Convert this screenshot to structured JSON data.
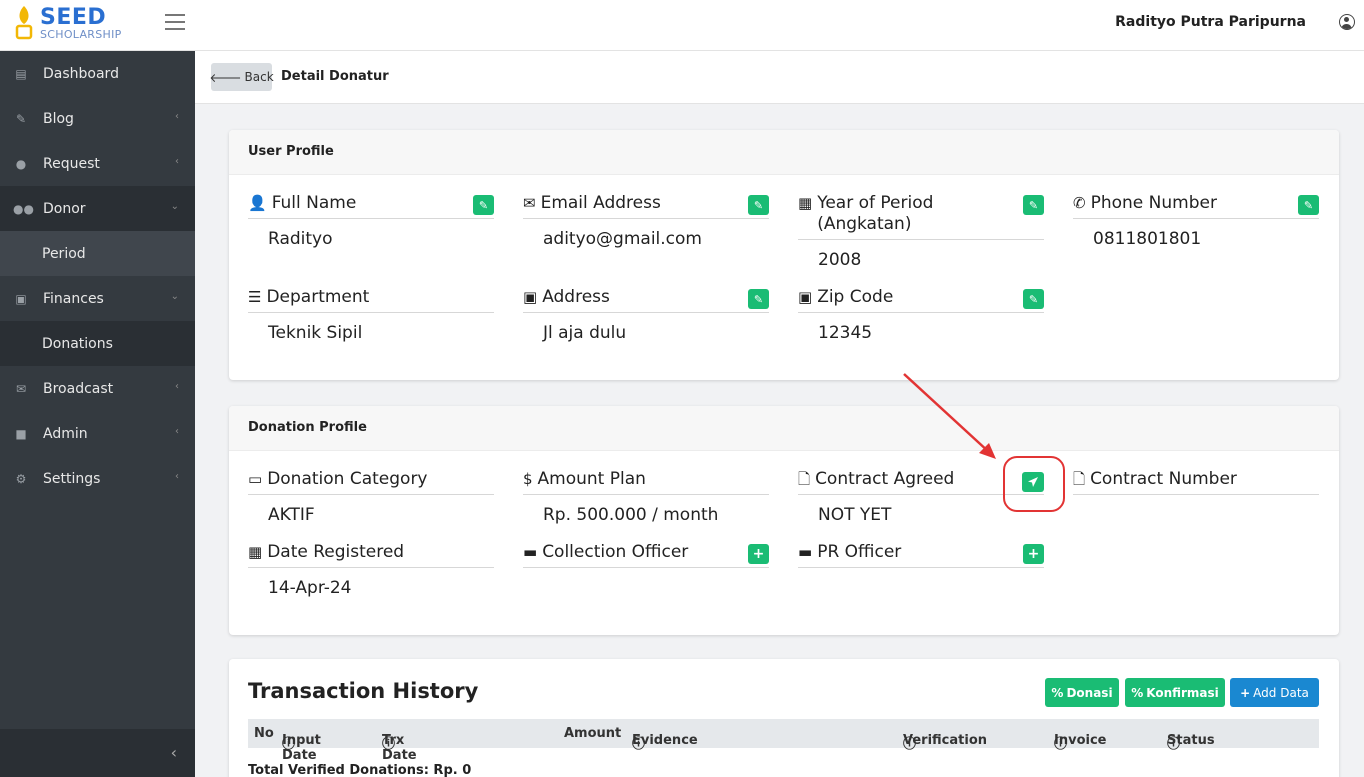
{
  "header": {
    "logo_title": "SEED",
    "logo_subtitle": "SCHOLARSHIP",
    "user_name": "Radityo Putra Paripurna"
  },
  "sidebar": {
    "items": [
      {
        "label": "Dashboard",
        "icon": "bar-chart-icon"
      },
      {
        "label": "Blog",
        "icon": "edit-icon"
      },
      {
        "label": "Request",
        "icon": "user-plus-icon"
      },
      {
        "label": "Donor",
        "icon": "users-icon"
      },
      {
        "label": "Period",
        "icon": ""
      },
      {
        "label": "Finances",
        "icon": "money-icon"
      },
      {
        "label": "Donations",
        "icon": ""
      },
      {
        "label": "Broadcast",
        "icon": "envelope-icon"
      },
      {
        "label": "Admin",
        "icon": "lock-icon"
      },
      {
        "label": "Settings",
        "icon": "gear-icon"
      }
    ]
  },
  "content_header": {
    "back_label": "Back",
    "title": "Detail Donatur"
  },
  "user_profile": {
    "title": "User Profile",
    "fields": [
      {
        "label": "Full Name",
        "value": "Radityo"
      },
      {
        "label": "Email Address",
        "value": "adityo@gmail.com"
      },
      {
        "label": "Year of Period (Angkatan)",
        "value": "2008"
      },
      {
        "label": "Phone Number",
        "value": "0811801801"
      },
      {
        "label": "Department",
        "value": "Teknik Sipil"
      },
      {
        "label": "Address",
        "value": "Jl aja dulu"
      },
      {
        "label": "Zip Code",
        "value": "12345"
      }
    ]
  },
  "donation_profile": {
    "title": "Donation Profile",
    "fields": [
      {
        "label": "Donation Category",
        "value": "AKTIF"
      },
      {
        "label": "Amount Plan",
        "value": "Rp. 500.000 / month"
      },
      {
        "label": "Contract Agreed",
        "value": "NOT YET"
      },
      {
        "label": "Contract Number",
        "value": ""
      },
      {
        "label": "Date Registered",
        "value": "14-Apr-24"
      },
      {
        "label": "Collection Officer",
        "value": ""
      },
      {
        "label": "PR Officer",
        "value": ""
      }
    ]
  },
  "transactions": {
    "title": "Transaction History",
    "buttons": {
      "donasi": "Donasi",
      "konfirmasi": "Konfirmasi",
      "add_data": "Add Data"
    },
    "columns": [
      "No",
      "Input Date",
      "Trx Date",
      "Amount",
      "Evidence",
      "Verification",
      "Invoice",
      "Status"
    ],
    "total_text": "Total Verified Donations: Rp. 0"
  },
  "colors": {
    "accent_green": "#1abc74",
    "accent_blue": "#1a88d1",
    "sidebar_bg": "#343a40",
    "highlight": "#e23434"
  }
}
